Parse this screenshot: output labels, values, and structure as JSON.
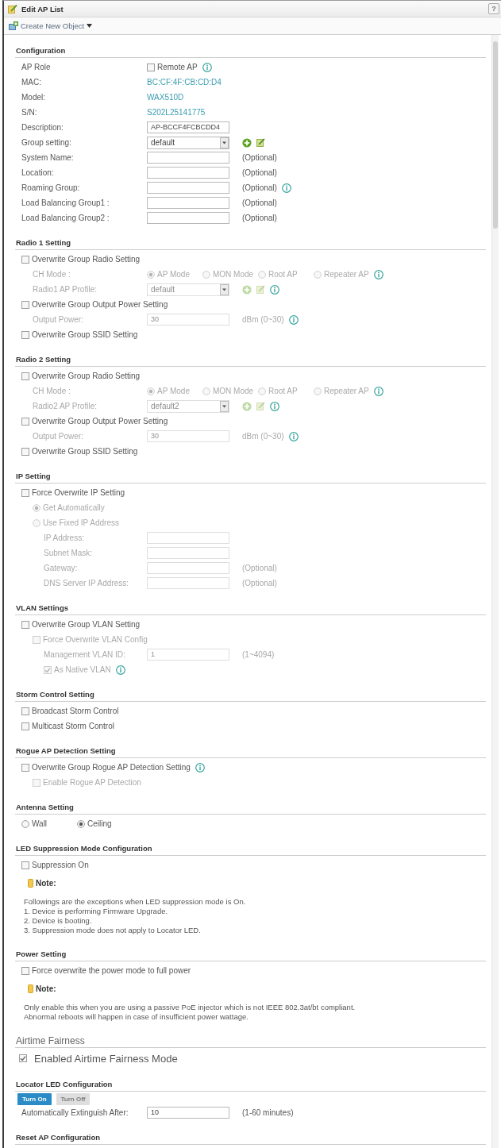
{
  "window": {
    "title": "Edit AP List",
    "help": "?"
  },
  "toolbar": {
    "label": "Create New Object"
  },
  "sections": [
    {
      "kind": "standard",
      "title": "Configuration",
      "rows": [
        {
          "kind": "option",
          "label": "AP Role",
          "option": "Remote AP",
          "checked": false,
          "info": true
        },
        {
          "kind": "text",
          "label": "MAC:",
          "value": "BC:CF:4F:CB:CD:D4"
        },
        {
          "kind": "text",
          "label": "Model:",
          "value": "WAX510D"
        },
        {
          "kind": "text",
          "label": "S/N:",
          "value": "S202L25141775"
        },
        {
          "kind": "input",
          "label": "Description:",
          "value": "AP-BCCF4FCBCDD4"
        },
        {
          "kind": "select",
          "label": "Group setting:",
          "value": "default",
          "actions": true
        },
        {
          "kind": "input",
          "label": "System Name:",
          "suffix": "(Optional)"
        },
        {
          "kind": "input",
          "label": "Location:",
          "suffix": "(Optional)"
        },
        {
          "kind": "input",
          "label": "Roaming Group:",
          "suffix": "(Optional)",
          "info": true
        },
        {
          "kind": "input",
          "label": "Load Balancing Group1 :",
          "suffix": "(Optional)"
        },
        {
          "kind": "input",
          "label": "Load Balancing Group2 :",
          "suffix": "(Optional)"
        }
      ]
    },
    {
      "kind": "standard",
      "title": "Radio 1 Setting",
      "rows": [
        {
          "kind": "checkbox",
          "label": "Overwrite Group Radio Setting",
          "checked": false,
          "children": [
            {
              "kind": "radios",
              "label": "CH Mode :",
              "options": [
                {
                  "label": "AP Mode",
                  "selected": true
                },
                {
                  "label": "MON Mode",
                  "selected": false
                },
                {
                  "label": "Root AP",
                  "selected": false
                },
                {
                  "label": "Repeater AP",
                  "selected": false
                }
              ],
              "info": true
            },
            {
              "kind": "select",
              "label": "Radio1 AP Profile:",
              "value": "default",
              "actions": true,
              "info": true
            }
          ]
        },
        {
          "kind": "checkbox",
          "label": "Overwrite Group Output Power Setting",
          "checked": false,
          "children": [
            {
              "kind": "input",
              "label": "Output Power:",
              "value": "30",
              "suffix": "dBm (0~30)",
              "info": true
            }
          ]
        },
        {
          "kind": "checkbox",
          "label": "Overwrite Group SSID Setting",
          "checked": false
        }
      ]
    },
    {
      "kind": "standard",
      "title": "Radio 2 Setting",
      "rows": [
        {
          "kind": "checkbox",
          "label": "Overwrite Group Radio Setting",
          "checked": false,
          "children": [
            {
              "kind": "radios",
              "label": "CH Mode :",
              "options": [
                {
                  "label": "AP Mode",
                  "selected": true
                },
                {
                  "label": "MON Mode",
                  "selected": false
                },
                {
                  "label": "Root AP",
                  "selected": false
                },
                {
                  "label": "Repeater AP",
                  "selected": false
                }
              ],
              "info": true
            },
            {
              "kind": "select",
              "label": "Radio2 AP Profile:",
              "value": "default2",
              "actions": true,
              "info": true
            }
          ]
        },
        {
          "kind": "checkbox",
          "label": "Overwrite Group Output Power Setting",
          "checked": false,
          "children": [
            {
              "kind": "input",
              "label": "Output Power:",
              "value": "30",
              "suffix": "dBm (0~30)",
              "info": true
            }
          ]
        },
        {
          "kind": "checkbox",
          "label": "Overwrite Group SSID Setting",
          "checked": false
        }
      ]
    },
    {
      "kind": "standard",
      "title": "IP Setting",
      "rows": [
        {
          "kind": "checkbox",
          "label": "Force Overwrite IP Setting",
          "checked": false,
          "children": [
            {
              "kind": "radio_list",
              "options": [
                {
                  "label": "Get Automatically",
                  "selected": true
                },
                {
                  "label": "Use Fixed IP Address",
                  "selected": false,
                  "children": [
                    {
                      "kind": "input",
                      "label": "IP Address:"
                    },
                    {
                      "kind": "input",
                      "label": "Subnet Mask:"
                    },
                    {
                      "kind": "input",
                      "label": "Gateway:",
                      "suffix": "(Optional)"
                    },
                    {
                      "kind": "input",
                      "label": "DNS Server IP Address:",
                      "suffix": "(Optional)"
                    }
                  ]
                }
              ]
            }
          ]
        }
      ]
    },
    {
      "kind": "standard",
      "title": "VLAN Settings",
      "rows": [
        {
          "kind": "checkbox",
          "label": "Overwrite Group VLAN Setting",
          "checked": false,
          "children": [
            {
              "kind": "checkbox",
              "label": "Force Overwrite VLAN Config",
              "checked": false,
              "children": [
                {
                  "kind": "input",
                  "label": "Management VLAN ID:",
                  "value": "1",
                  "suffix": "(1~4094)"
                },
                {
                  "kind": "checkbox",
                  "label": "As Native VLAN",
                  "checked": true,
                  "info": true
                }
              ]
            }
          ]
        }
      ]
    },
    {
      "kind": "standard",
      "title": "Storm Control Setting",
      "rows": [
        {
          "kind": "checkbox",
          "label": "Broadcast Storm Control",
          "checked": false
        },
        {
          "kind": "checkbox",
          "label": "Multicast Storm Control",
          "checked": false
        }
      ]
    },
    {
      "kind": "standard",
      "title": "Rogue AP Detection Setting",
      "rows": [
        {
          "kind": "checkbox",
          "label": "Overwrite Group Rogue AP Detection Setting",
          "checked": false,
          "info": true,
          "children": [
            {
              "kind": "checkbox",
              "label": "Enable Rogue AP Detection",
              "checked": false
            }
          ]
        }
      ]
    },
    {
      "kind": "standard",
      "title": "Antenna Setting",
      "rows": [
        {
          "kind": "radios",
          "options": [
            {
              "label": "Wall",
              "selected": false
            },
            {
              "label": "Ceiling",
              "selected": true
            }
          ]
        }
      ]
    },
    {
      "kind": "standard",
      "title": "LED Suppression Mode Configuration",
      "rows": [
        {
          "kind": "checkbox",
          "label": "Suppression On",
          "checked": false
        },
        {
          "kind": "note",
          "title": "Note:",
          "lines": [
            "Followings are the exceptions when LED suppression mode is On.",
            "1. Device is performing Firmware Upgrade.",
            "2. Device is booting.",
            "3. Suppression mode does not apply to Locator LED."
          ]
        }
      ]
    },
    {
      "kind": "standard",
      "title": "Power Setting",
      "rows": [
        {
          "kind": "checkbox",
          "label": "Force overwrite the power mode to full power",
          "checked": false
        },
        {
          "kind": "note",
          "title": "Note:",
          "lines": [
            "Only enable this when you are using a passive PoE injector which is not IEEE 802.3at/bt compliant.",
            "Abnormal reboots will happen in case of insufficient power wattage."
          ]
        }
      ]
    },
    {
      "kind": "large",
      "title": "Airtime Fairness",
      "rows": [
        {
          "kind": "checkbox",
          "label": "Enabled Airtime Fairness Mode",
          "checked": true
        }
      ]
    },
    {
      "kind": "standard",
      "title": "Locator LED Configuration",
      "rows": [
        {
          "kind": "buttons",
          "buttons": [
            {
              "label": "Turn On",
              "disabled": false
            },
            {
              "label": "Turn Off",
              "disabled": true
            }
          ]
        },
        {
          "kind": "input",
          "label": "Automatically Extinguish After:",
          "value": "10",
          "suffix": "(1-60 minutes)"
        }
      ]
    },
    {
      "kind": "standard",
      "title": "Reset AP Configuration"
    }
  ]
}
